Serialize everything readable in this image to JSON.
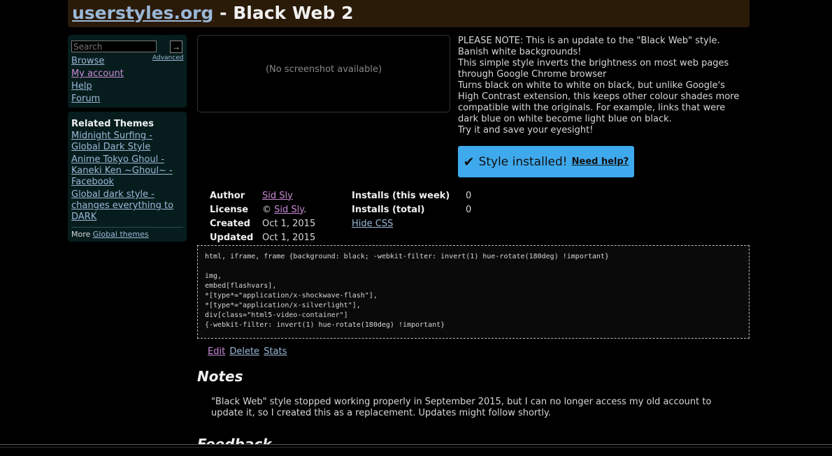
{
  "header": {
    "site_link": "userstyles.org",
    "separator": " - ",
    "style_name": "Black Web 2"
  },
  "sidebar": {
    "search_placeholder": "Search",
    "search_button": "→",
    "advanced_link": "Advanced",
    "nav": [
      {
        "label": "Browse"
      },
      {
        "label": "My account"
      },
      {
        "label": "Help"
      },
      {
        "label": "Forum"
      }
    ],
    "related": {
      "title": "Related Themes",
      "items": [
        {
          "label": "Midnight Surfing - Global Dark Style"
        },
        {
          "label": "Anime Tokyo Ghoul - Kaneki Ken ~Ghoul~ - Facebook"
        },
        {
          "label": "Global dark style - changes everything to DARK"
        }
      ],
      "more_prefix": "More",
      "more_link": "Global themes"
    }
  },
  "screenshot": {
    "placeholder": "(No screenshot available)"
  },
  "description": [
    "PLEASE NOTE: This is an update to the \"Black Web\" style.",
    "Banish white backgrounds!",
    "This simple style inverts the brightness on most web pages through Google Chrome browser",
    "Turns black on white to white on black, but unlike Google's High Contrast extension, this keeps other colour shades more compatible with the originals. For example, links that were dark blue on white become light blue on black.",
    "Try it and save your eyesight!"
  ],
  "install": {
    "check": "✔",
    "label": "Style installed!",
    "help_link": "Need help?"
  },
  "meta": {
    "author_label": "Author",
    "author_value": "Sid Sly",
    "license_label": "License",
    "license_prefix": "© ",
    "license_value": "Sid Sly",
    "license_suffix": ".",
    "created_label": "Created",
    "created_value": "Oct 1, 2015",
    "updated_label": "Updated",
    "updated_value": "Oct 1, 2015",
    "installs_week_label": "Installs (this week)",
    "installs_week_value": "0",
    "installs_total_label": "Installs (total)",
    "installs_total_value": "0",
    "hide_css_link": "Hide CSS"
  },
  "css_code": "html, iframe, frame {background: black; -webkit-filter: invert(1) hue-rotate(180deg) !important}\n\nimg,\nembed[flashvars],\n*[type*=\"application/x-shockwave-flash\"],\n*[type*=\"application/x-silverlight\"],\ndiv[class=\"html5-video-container\"]\n{-webkit-filter: invert(1) hue-rotate(180deg) !important}",
  "actions": {
    "edit": "Edit",
    "delete": "Delete",
    "stats": "Stats"
  },
  "notes": {
    "heading": "Notes",
    "text": "\"Black Web\" style stopped working properly in September 2015, but I can no longer access my old account to update it, so I created this as a replacement. Updates might follow shortly."
  },
  "feedback": {
    "heading": "Feedback"
  },
  "colors": {
    "background": "#000000",
    "header_bg": "#2a1a08",
    "sidebar_bg": "#071d1d",
    "link": "#9ab8d8",
    "visited_link": "#c98ad6",
    "install_button": "#3fa9ee"
  }
}
